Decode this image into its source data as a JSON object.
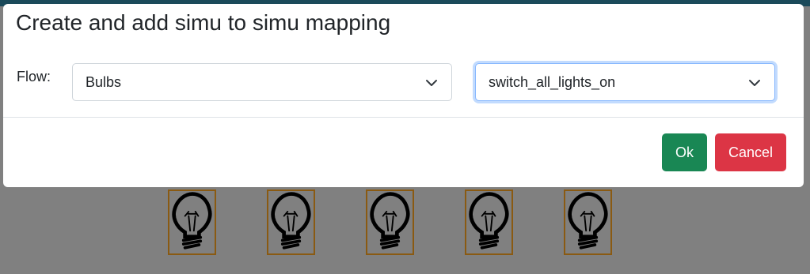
{
  "dialog": {
    "title": "Create and add simu to simu mapping",
    "flow_label": "Flow:",
    "flow_select_value": "Bulbs",
    "action_select_value": "switch_all_lights_on",
    "ok_label": "Ok",
    "cancel_label": "Cancel"
  },
  "background": {
    "bulbs": [
      {
        "icon": "light-bulb-icon"
      },
      {
        "icon": "light-bulb-icon"
      },
      {
        "icon": "light-bulb-icon"
      },
      {
        "icon": "light-bulb-icon"
      },
      {
        "icon": "light-bulb-icon"
      }
    ]
  },
  "colors": {
    "ok": "#198754",
    "cancel": "#dc3545",
    "focus_border": "#86b7fe",
    "backdrop": "#808080"
  }
}
